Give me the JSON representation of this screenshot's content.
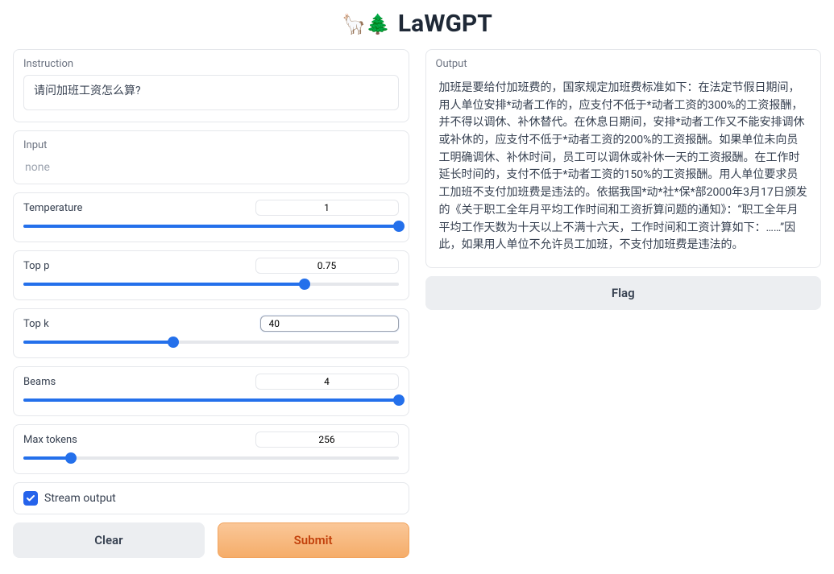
{
  "header": {
    "emoji": "🦙🌲",
    "title": "LaWGPT"
  },
  "left": {
    "instruction": {
      "label": "Instruction",
      "value": "请问加班工资怎么算?"
    },
    "input": {
      "label": "Input",
      "placeholder": "none"
    },
    "sliders": {
      "temperature": {
        "label": "Temperature",
        "value": "1",
        "fillPct": 100
      },
      "top_p": {
        "label": "Top p",
        "value": "0.75",
        "fillPct": 75
      },
      "top_k": {
        "label": "Top k",
        "value": "40",
        "fillPct": 40
      },
      "beams": {
        "label": "Beams",
        "value": "4",
        "fillPct": 100
      },
      "max_tokens": {
        "label": "Max tokens",
        "value": "256",
        "fillPct": 12.6
      }
    },
    "stream_output": {
      "label": "Stream output",
      "checked": true
    },
    "buttons": {
      "clear": "Clear",
      "submit": "Submit"
    }
  },
  "right": {
    "output": {
      "label": "Output",
      "text": "加班是要给付加班费的，国家规定加班费标准如下：在法定节假日期间，用人单位安排*动者工作的，应支付不低于*动者工资的300%的工资报酬，并不得以调休、补休替代。在休息日期间，安排*动者工作又不能安排调休或补休的，应支付不低于*动者工资的200%的工资报酬。如果单位未向员工明确调休、补休时间，员工可以调休或补休一天的工资报酬。在工作时延长时间的，支付不低于*动者工资的150%的工资报酬。用人单位要求员工加班不支付加班费是违法的。依据我国*动*社*保*部2000年3月17日颁发的《关于职工全年月平均工作时间和工资折算问题的通知》：“职工全年月平均工作天数为十天以上不满十六天，工作时间和工资计算如下：……”因此，如果用人单位不允许员工加班，不支付加班费是违法的。"
    },
    "flag": "Flag"
  }
}
